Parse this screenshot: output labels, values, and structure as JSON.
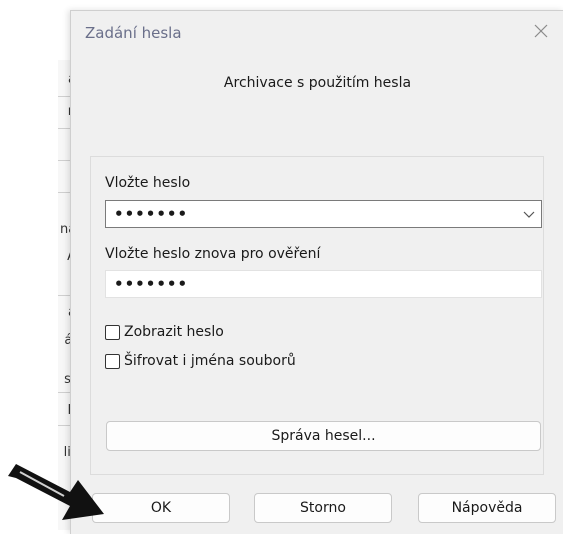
{
  "background_window": {
    "fragments": [
      "a",
      "n",
      "ná",
      "A",
      "a",
      "ál",
      "st",
      "K",
      "lit"
    ]
  },
  "dialog": {
    "title": "Zadání hesla",
    "subtitle": "Archivace s použitím hesla",
    "password_label": "Vložte heslo",
    "password_value": "•••••••",
    "confirm_label": "Vložte heslo znova pro ověření",
    "confirm_value": "•••••••",
    "show_password_label": "Zobrazit heslo",
    "encrypt_filenames_label": "Šifrovat i jména souborů",
    "manage_passwords_label": "Správa hesel...",
    "buttons": {
      "ok": "OK",
      "cancel": "Storno",
      "help": "Nápověda"
    }
  },
  "icons": {
    "close": "close-icon",
    "dropdown": "chevron-down-icon",
    "pointer": "arrow-icon"
  },
  "colors": {
    "title_text": "#6a6f8a",
    "dialog_bg": "#f0f0f0"
  }
}
